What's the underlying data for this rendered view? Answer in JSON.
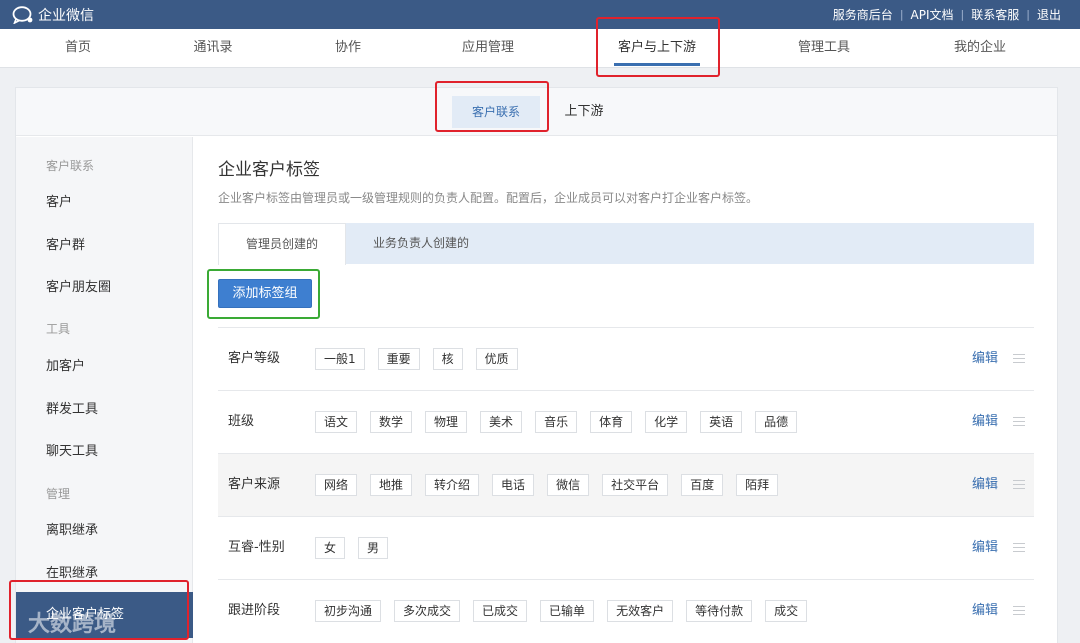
{
  "app": {
    "name": "企业微信"
  },
  "top_links": [
    "服务商后台",
    "API文档",
    "联系客服",
    "退出"
  ],
  "main_nav": [
    {
      "label": "首页"
    },
    {
      "label": "通讯录"
    },
    {
      "label": "协作"
    },
    {
      "label": "应用管理"
    },
    {
      "label": "客户与上下游",
      "active": true
    },
    {
      "label": "管理工具"
    },
    {
      "label": "我的企业"
    }
  ],
  "sub_tabs": [
    {
      "label": "客户联系",
      "active": true
    },
    {
      "label": "上下游"
    }
  ],
  "sidebar": {
    "groups": [
      {
        "title": "客户联系",
        "items": [
          "客户",
          "客户群",
          "客户朋友圈"
        ]
      },
      {
        "title": "工具",
        "items": [
          "加客户",
          "群发工具",
          "聊天工具"
        ]
      },
      {
        "title": "管理",
        "items": [
          "离职继承",
          "在职继承",
          "企业客户标签"
        ]
      }
    ],
    "active_item": "企业客户标签"
  },
  "content": {
    "title": "企业客户标签",
    "description": "企业客户标签由管理员或一级管理规则的负责人配置。配置后，企业成员可以对客户打企业客户标签。",
    "tabs": [
      {
        "label": "管理员创建的",
        "active": true
      },
      {
        "label": "业务负责人创建的"
      }
    ],
    "add_button": "添加标签组",
    "edit_label": "编辑",
    "tag_groups": [
      {
        "name": "客户等级",
        "tags": [
          "一般1",
          "重要",
          "核",
          "优质"
        ]
      },
      {
        "name": "班级",
        "tags": [
          "语文",
          "数学",
          "物理",
          "美术",
          "音乐",
          "体育",
          "化学",
          "英语",
          "品德"
        ]
      },
      {
        "name": "客户来源",
        "tags": [
          "网络",
          "地推",
          "转介绍",
          "电话",
          "微信",
          "社交平台",
          "百度",
          "陌拜"
        ],
        "highlighted": true
      },
      {
        "name": "互睿-性别",
        "tags": [
          "女",
          "男"
        ]
      },
      {
        "name": "跟进阶段",
        "tags": [
          "初步沟通",
          "多次成交",
          "已成交",
          "已输单",
          "无效客户",
          "等待付款",
          "成交"
        ]
      }
    ]
  },
  "watermark": "大数跨境",
  "colors": {
    "topbar": "#3b5a86",
    "accent": "#3a6fb0",
    "button": "#3e7fd0",
    "annotation_red": "#e0222c",
    "annotation_green": "#3aaa35"
  }
}
